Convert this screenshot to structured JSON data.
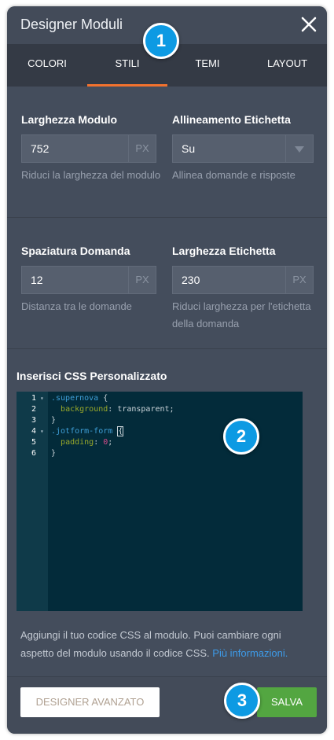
{
  "panel": {
    "title": "Designer Moduli"
  },
  "tabs": [
    {
      "label": "COLORI",
      "active": false
    },
    {
      "label": "STILI",
      "active": true
    },
    {
      "label": "TEMI",
      "active": false
    },
    {
      "label": "LAYOUT",
      "active": false
    }
  ],
  "fields": {
    "form_width": {
      "label": "Larghezza Modulo",
      "value": "752",
      "unit": "PX",
      "hint": "Riduci la larghezza del modulo"
    },
    "label_alignment": {
      "label": "Allineamento Etichetta",
      "value": "Su",
      "hint": "Allinea domande e risposte"
    },
    "question_spacing": {
      "label": "Spaziatura Domanda",
      "value": "12",
      "unit": "PX",
      "hint": "Distanza tra le domande"
    },
    "label_width": {
      "label": "Larghezza Etichetta",
      "value": "230",
      "unit": "PX",
      "hint": "Riduci larghezza per l'etichetta della domanda"
    }
  },
  "custom_css": {
    "title": "Inserisci CSS Personalizzato",
    "line_numbers": [
      "1",
      "2",
      "3",
      "4",
      "5",
      "6"
    ],
    "lines": [
      {
        "selector": ".supernova",
        "brace": " {"
      },
      {
        "property": "background",
        "value": "transparent;"
      },
      {
        "text": "}"
      },
      {
        "selector": ".jotform-form",
        "brace": "{"
      },
      {
        "property": "padding",
        "number": "0",
        "end": ";"
      },
      {
        "text": "}"
      }
    ]
  },
  "footer": {
    "description": "Aggiungi il tuo codice CSS al modulo. Puoi cambiare ogni aspetto del modulo usando il codice CSS.",
    "link": "Più informazioni."
  },
  "buttons": {
    "advanced": "DESIGNER AVANZATO",
    "save": "SALVA"
  },
  "badges": [
    "1",
    "2",
    "3"
  ],
  "colors": {
    "accent_tab": "#f2722e",
    "save_button": "#53a641",
    "badge": "#0d9ae3",
    "link": "#3d9be9"
  }
}
